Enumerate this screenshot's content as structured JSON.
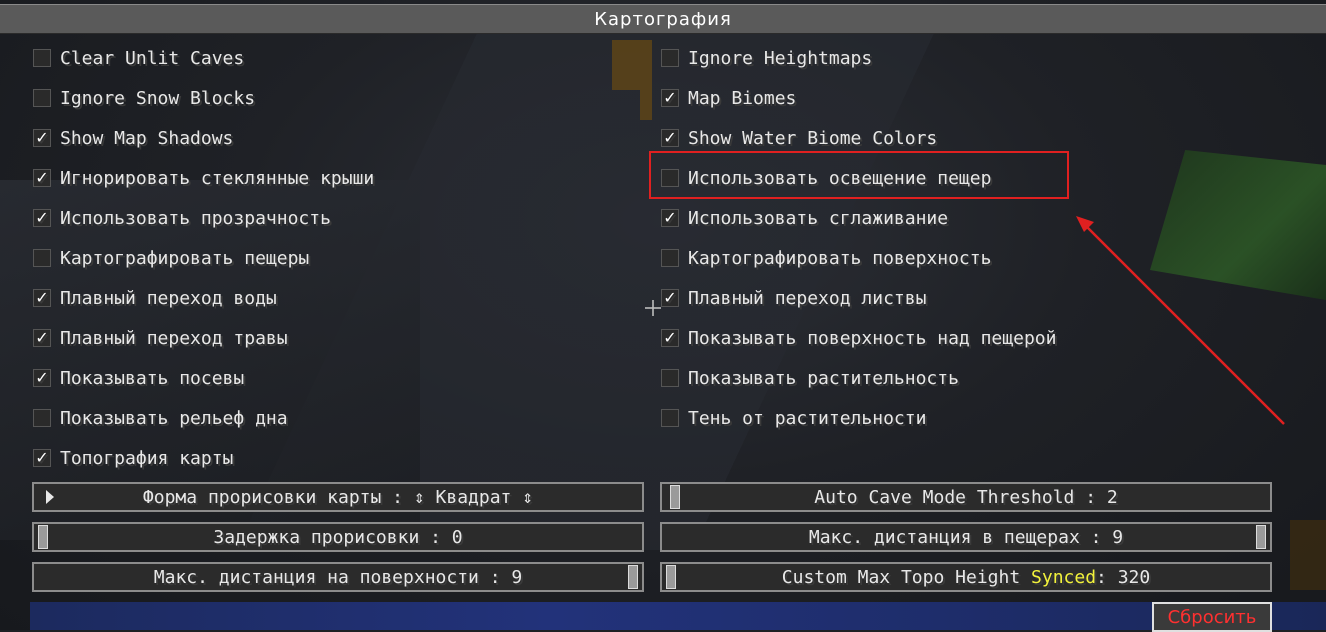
{
  "window": {
    "title": "Картография"
  },
  "left_options": [
    {
      "label": "Clear Unlit Caves",
      "checked": false
    },
    {
      "label": "Ignore Snow Blocks",
      "checked": false
    },
    {
      "label": "Show Map Shadows",
      "checked": true
    },
    {
      "label": "Игнорировать стеклянные крыши",
      "checked": true
    },
    {
      "label": "Использовать прозрачность",
      "checked": true
    },
    {
      "label": "Картографировать пещеры",
      "checked": false
    },
    {
      "label": "Плавный переход воды",
      "checked": true
    },
    {
      "label": "Плавный переход травы",
      "checked": true
    },
    {
      "label": "Показывать посевы",
      "checked": true
    },
    {
      "label": "Показывать рельеф дна",
      "checked": false
    },
    {
      "label": "Топография карты",
      "checked": true
    }
  ],
  "right_options": [
    {
      "label": "Ignore Heightmaps",
      "checked": false
    },
    {
      "label": "Map Biomes",
      "checked": true
    },
    {
      "label": "Show Water Biome Colors",
      "checked": true
    },
    {
      "label": "Использовать освещение пещер",
      "checked": false
    },
    {
      "label": "Использовать сглаживание",
      "checked": true
    },
    {
      "label": "Картографировать поверхность",
      "checked": false
    },
    {
      "label": "Плавный переход листвы",
      "checked": true
    },
    {
      "label": "Показывать поверхность над пещерой",
      "checked": true
    },
    {
      "label": "Показывать растительность",
      "checked": false
    },
    {
      "label": "Тень от растительности",
      "checked": false
    }
  ],
  "controls": {
    "render_shape": "Форма прорисовки карты : ⇕ Квадрат ⇕",
    "auto_cave": "Auto Cave Mode Threshold : 2",
    "render_delay": "Задержка прорисовки : 0",
    "max_cave_distance": "Макс. дистанция в пещерах : 9",
    "max_surface_distance": "Макс. дистанция на поверхности : 9",
    "topo_label": "Custom Max Topo Height ",
    "topo_synced": "Synced",
    "topo_value": ": 320",
    "reset": "Сбросить"
  },
  "colors": {
    "highlight": "#e02020",
    "synced": "#f2f23c",
    "reset_text": "#ff3030"
  }
}
